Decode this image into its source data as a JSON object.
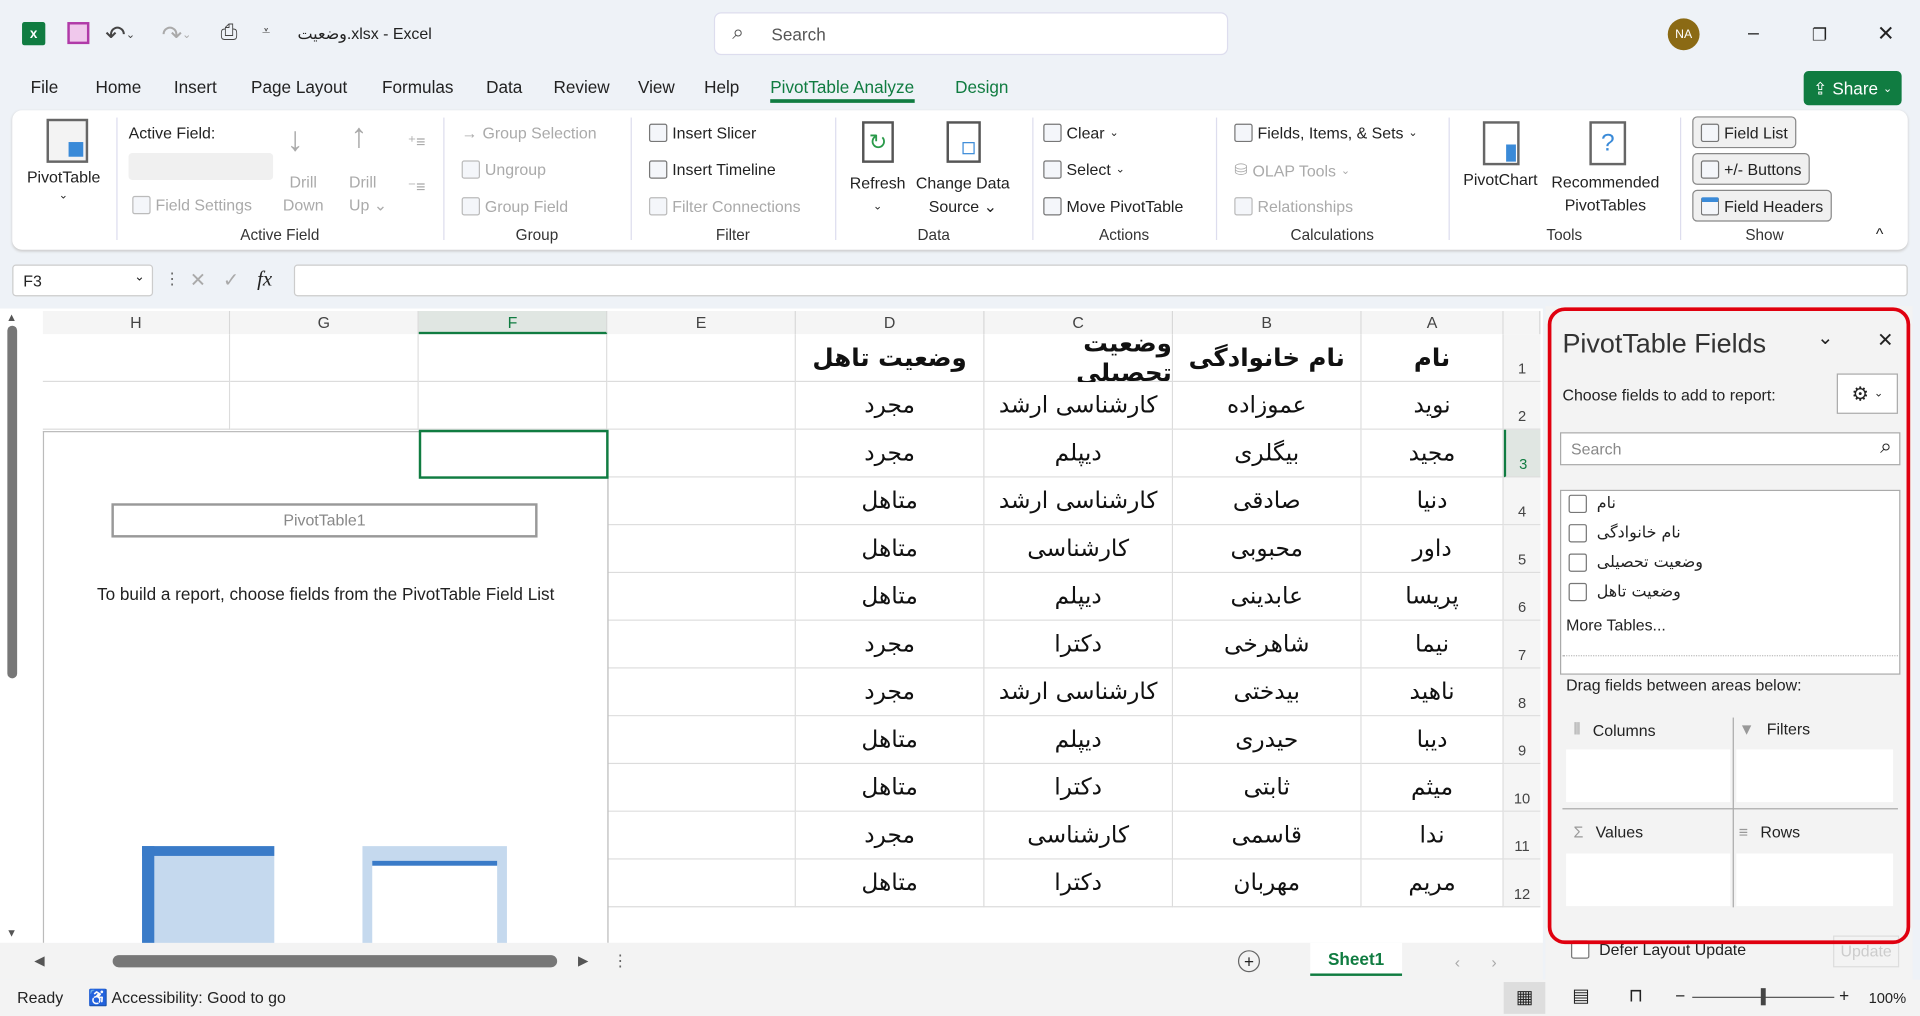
{
  "titlebar": {
    "title": "وضعیت.xlsx - Excel",
    "search_placeholder": "Search",
    "avatar": "NA",
    "avatar_color": "#8b6a14"
  },
  "menu": {
    "tabs": [
      "File",
      "Home",
      "Insert",
      "Page Layout",
      "Formulas",
      "Data",
      "Review",
      "View",
      "Help",
      "PivotTable Analyze",
      "Design"
    ],
    "active": "PivotTable Analyze",
    "share": "Share",
    "accent": "#107c41"
  },
  "ribbon": {
    "pivottable": {
      "label": "PivotTable"
    },
    "active_field": {
      "label": "Active Field:",
      "field_settings": "Field Settings",
      "drill_down": [
        "Drill",
        "Down"
      ],
      "drill_up": [
        "Drill",
        "Up"
      ],
      "group": "Active Field"
    },
    "group": {
      "group_selection": "Group Selection",
      "ungroup": "Ungroup",
      "group_field": "Group Field",
      "group": "Group"
    },
    "filter": {
      "insert_slicer": "Insert Slicer",
      "insert_timeline": "Insert Timeline",
      "filter_connections": "Filter Connections",
      "group": "Filter"
    },
    "data": {
      "refresh": "Refresh",
      "change_source": [
        "Change Data",
        "Source"
      ],
      "group": "Data"
    },
    "actions": {
      "clear": "Clear",
      "select": "Select",
      "move": "Move PivotTable",
      "group": "Actions"
    },
    "calculations": {
      "fields": "Fields, Items, & Sets",
      "olap": "OLAP Tools",
      "relationships": "Relationships",
      "group": "Calculations"
    },
    "tools": {
      "pivotchart": "PivotChart",
      "recommended": [
        "Recommended",
        "PivotTables"
      ],
      "group": "Tools"
    },
    "show": {
      "field_list": "Field List",
      "buttons": "+/- Buttons",
      "field_headers": "Field Headers",
      "group": "Show"
    }
  },
  "formula_bar": {
    "name_box": "F3",
    "fx": "fx",
    "value": ""
  },
  "sheet": {
    "columns": [
      "H",
      "G",
      "F",
      "E",
      "D",
      "C",
      "B",
      "A"
    ],
    "rows": [
      "1",
      "2",
      "3",
      "4",
      "5",
      "6",
      "7",
      "8",
      "9",
      "10",
      "11",
      "12"
    ],
    "headers": [
      "نام",
      "نام خانوادگی",
      "وضعیت تحصیلی",
      "وضعیت تاهل"
    ],
    "data": [
      [
        "نوید",
        "عموزاده",
        "کارشناسی ارشد",
        "مجرد"
      ],
      [
        "مجید",
        "بیگلری",
        "دیپلم",
        "مجرد"
      ],
      [
        "دنیا",
        "صادقی",
        "کارشناسی ارشد",
        "متاهل"
      ],
      [
        "داور",
        "محبوبی",
        "کارشناسی",
        "متاهل"
      ],
      [
        "پریسا",
        "عابدینی",
        "دیپلم",
        "متاهل"
      ],
      [
        "نیما",
        "شاهرخی",
        "دکترا",
        "مجرد"
      ],
      [
        "ناهید",
        "بیدختی",
        "کارشناسی ارشد",
        "مجرد"
      ],
      [
        "دیبا",
        "حیدری",
        "دیپلم",
        "متاهل"
      ],
      [
        "میثم",
        "ثابتی",
        "دکترا",
        "متاهل"
      ],
      [
        "ندا",
        "قاسمی",
        "کارشناسی",
        "مجرد"
      ],
      [
        "مریم",
        "مهربان",
        "دکترا",
        "متاهل"
      ]
    ],
    "pivot_name": "PivotTable1",
    "pivot_hint": "To build a report, choose fields from the PivotTable Field List",
    "sheet_tab": "Sheet1"
  },
  "pane": {
    "title": "PivotTable Fields",
    "choose": "Choose fields to add to report:",
    "search_placeholder": "Search",
    "fields": [
      "نام",
      "نام خانوادگی",
      "وضعیت تحصیلی",
      "وضعیت تاهل"
    ],
    "more_tables": "More Tables...",
    "drag": "Drag fields between areas below:",
    "areas": {
      "columns": "Columns",
      "filters": "Filters",
      "values": "Values",
      "rows": "Rows"
    },
    "defer": "Defer Layout Update",
    "update": "Update",
    "highlight": "#e0000f"
  },
  "status": {
    "ready": "Ready",
    "accessibility": "Accessibility: Good to go",
    "zoom": "100%",
    "zoom_value": 100
  }
}
